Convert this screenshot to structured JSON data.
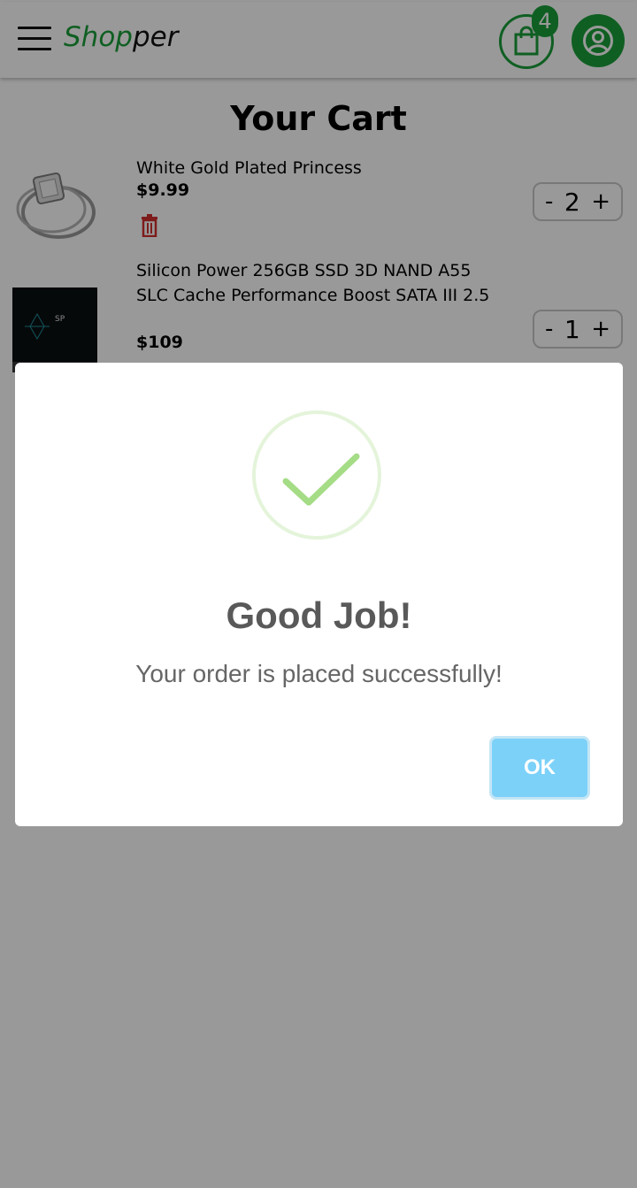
{
  "header": {
    "brand_part1": "Shop",
    "brand_part2": "per",
    "cart_count": "4",
    "brand_color": "#1a9e3a"
  },
  "cart": {
    "title": "Your Cart",
    "items": [
      {
        "name": "White Gold Plated Princess",
        "price": "$9.99",
        "qty": "2",
        "minus": "-",
        "plus": "+"
      },
      {
        "name": "Silicon Power 256GB SSD 3D NAND A55 SLC Cache Performance Boost SATA III 2.5",
        "price": "$109",
        "qty": "1",
        "minus": "-",
        "plus": "+"
      }
    ]
  },
  "dialog": {
    "title": "Good Job!",
    "text": "Your order is placed successfully!",
    "ok_label": "OK",
    "icon": "success-check-icon",
    "ok_color": "#7cd1f9"
  }
}
